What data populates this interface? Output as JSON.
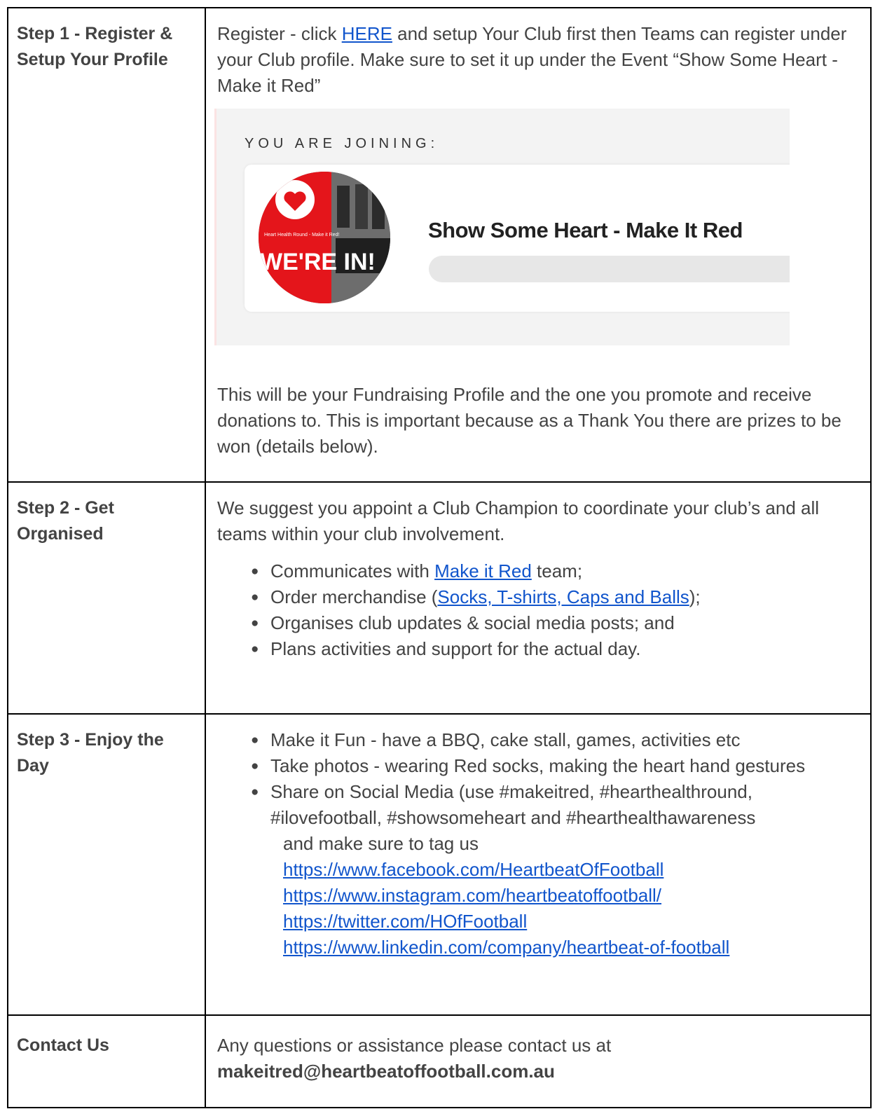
{
  "rows": [
    {
      "label": "Step 1 - Register & Setup Your Profile",
      "intro_before_link": "Register - click ",
      "intro_link": "HERE",
      "intro_after_link": " and setup Your Club first then Teams can register under your Club profile. Make sure to set it up under the Event “Show Some Heart - Make it Red”",
      "join_card": {
        "heading": "YOU ARE JOINING:",
        "event_name": "Show Some Heart - Make It Red",
        "avatar_text_big": "WE'RE IN!",
        "avatar_text_small": "Heart Health Round - Make it Red!"
      },
      "paragraph": "This will be your Fundraising Profile and the one you promote and receive donations to. This is important because as a Thank You there are prizes to be won (details below)."
    },
    {
      "label": "Step 2 - Get Organised",
      "paragraph": "We suggest you appoint a Club Champion to coordinate your club’s and all teams within your club involvement.",
      "bullets": [
        {
          "before": "Communicates with ",
          "link": "Make it Red",
          "after": " team;"
        },
        {
          "before": "Order merchandise (",
          "link": "Socks, T-shirts, Caps and Balls",
          "after": ");"
        },
        {
          "before": "Organises club updates & social media posts; and",
          "link": "",
          "after": ""
        },
        {
          "before": "Plans activities and support for the actual day.",
          "link": "",
          "after": ""
        }
      ]
    },
    {
      "label": "Step 3 - Enjoy the Day",
      "bullets": [
        "Make it Fun - have a BBQ, cake stall, games, activities etc",
        "Take photos - wearing Red socks, making the heart hand gestures",
        "Share on Social Media (use #makeitred, #hearthealthround,"
      ],
      "bullet3_cont": "#ilovefootball, #showsomeheart and #hearthealthawareness",
      "tag_text": "and make sure to tag us",
      "links": [
        "https://www.facebook.com/HeartbeatOfFootball",
        "https://www.instagram.com/heartbeatoffootball/",
        "https://twitter.com/HOfFootball",
        "https://www.linkedin.com/company/heartbeat-of-football"
      ]
    },
    {
      "label": "Contact Us",
      "paragraph": "Any questions or assistance please contact us at",
      "email": "makeitred@heartbeatoffootball.com.au"
    }
  ],
  "colors": {
    "link": "#1155cc",
    "text": "#434343",
    "brand_red": "#e4151b"
  }
}
